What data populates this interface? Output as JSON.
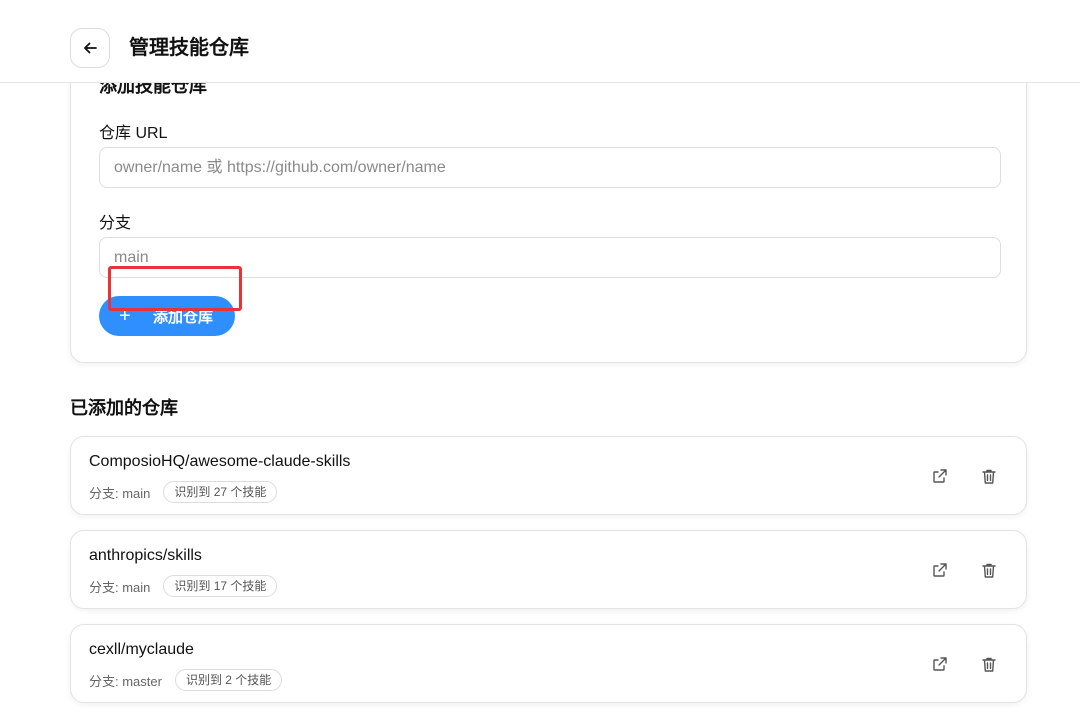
{
  "header": {
    "title": "管理技能仓库",
    "back_icon": "arrow-left-icon"
  },
  "add_card": {
    "heading": "添加技能仓库",
    "url_label": "仓库 URL",
    "url_placeholder": "owner/name 或 https://github.com/owner/name",
    "url_value": "",
    "branch_label": "分支",
    "branch_placeholder": "main",
    "branch_value": "",
    "add_button_icon": "plus-icon",
    "add_button_label": "添加仓库"
  },
  "repos_section": {
    "title": "已添加的仓库",
    "items": [
      {
        "name": "ComposioHQ/awesome-claude-skills",
        "branch": "分支: main",
        "badge": "识别到 27 个技能"
      },
      {
        "name": "anthropics/skills",
        "branch": "分支: main",
        "badge": "识别到 17 个技能"
      },
      {
        "name": "cexll/myclaude",
        "branch": "分支: master",
        "badge": "识别到 2 个技能"
      }
    ]
  },
  "colors": {
    "accent": "#2f8fff",
    "highlight_border": "#e8333b"
  }
}
